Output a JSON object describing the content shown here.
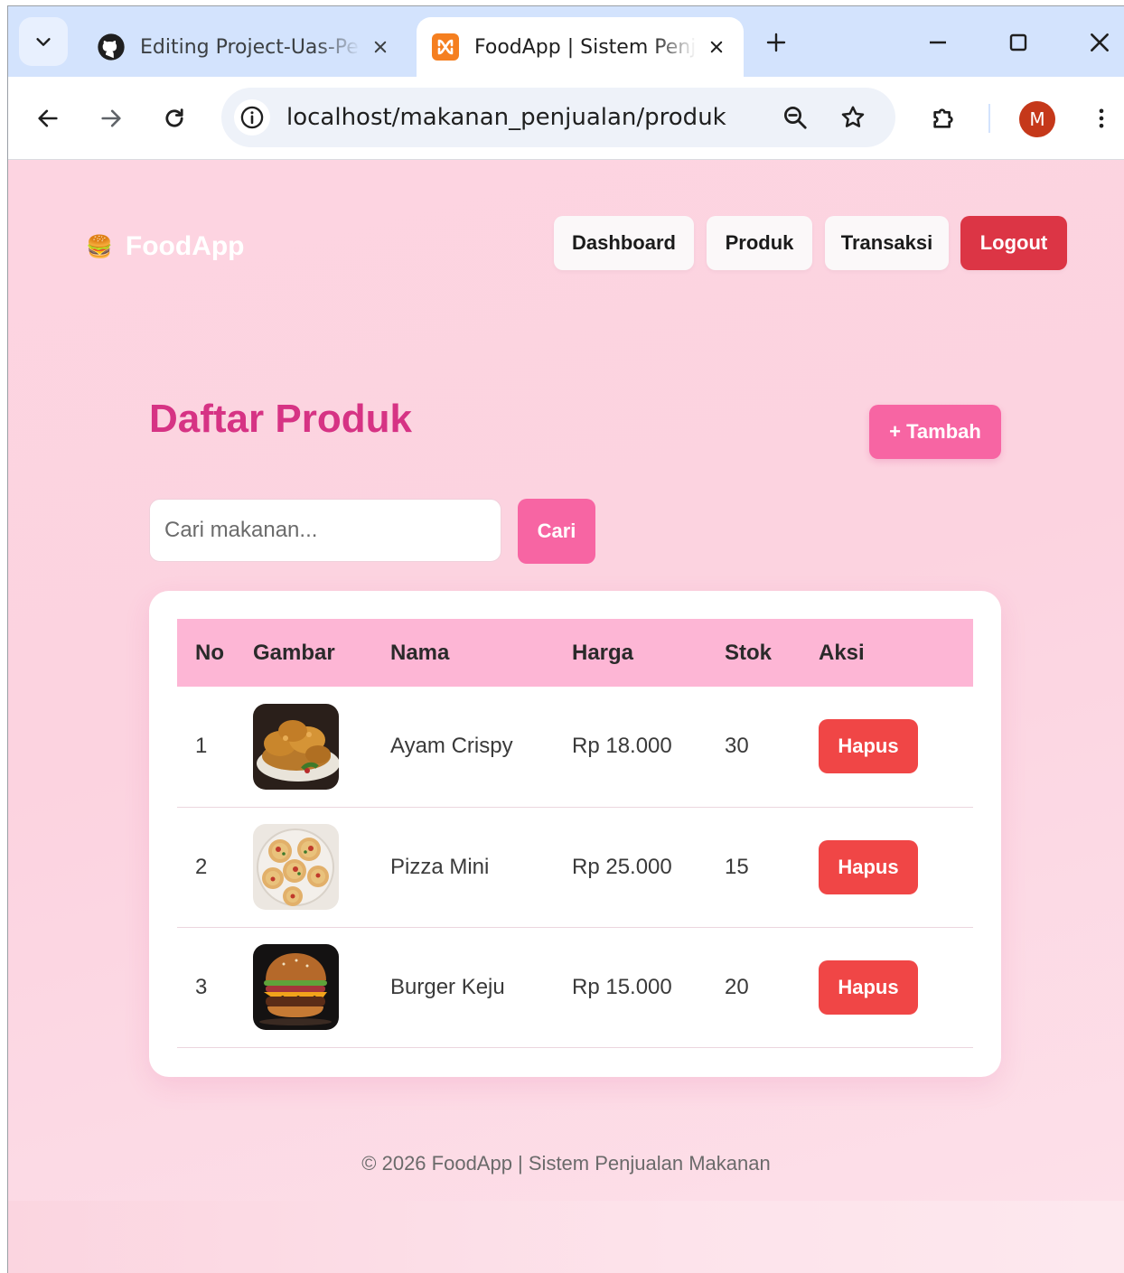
{
  "browser": {
    "tabs": [
      {
        "title": "Editing Project-Uas-Pe",
        "favicon": "github-icon",
        "active": false
      },
      {
        "title": "FoodApp | Sistem Penj",
        "favicon": "xampp-icon",
        "active": true
      }
    ],
    "url": "localhost/makanan_penjualan/produk",
    "profile_initial": "M",
    "profile_color": "#c5381a"
  },
  "navbar": {
    "brand_icon": "🍔",
    "brand": "FoodApp",
    "links": [
      "Dashboard",
      "Produk",
      "Transaksi"
    ],
    "logout": "Logout",
    "logout_color": "#dc3545"
  },
  "main": {
    "title": "Daftar Produk",
    "add_button": "+ Tambah",
    "search": {
      "placeholder": "Cari makanan...",
      "value": "",
      "button": "Cari"
    },
    "table": {
      "headers": [
        "No",
        "Gambar",
        "Nama",
        "Harga",
        "Stok",
        "Aksi"
      ],
      "rows": [
        {
          "no": "1",
          "image": "fried-chicken-image",
          "name": "Ayam Crispy",
          "price": "Rp 18.000",
          "stock": "30",
          "action": "Hapus"
        },
        {
          "no": "2",
          "image": "mini-pizza-image",
          "name": "Pizza Mini",
          "price": "Rp 25.000",
          "stock": "15",
          "action": "Hapus"
        },
        {
          "no": "3",
          "image": "cheeseburger-image",
          "name": "Burger Keju",
          "price": "Rp 15.000",
          "stock": "20",
          "action": "Hapus"
        }
      ]
    }
  },
  "footer": "© 2026 FoodApp | Sistem Penjualan Makanan",
  "colors": {
    "accent": "#d63384",
    "button_pink": "#f765a3",
    "delete_red": "#f04646",
    "table_header": "#fdb6d5"
  }
}
